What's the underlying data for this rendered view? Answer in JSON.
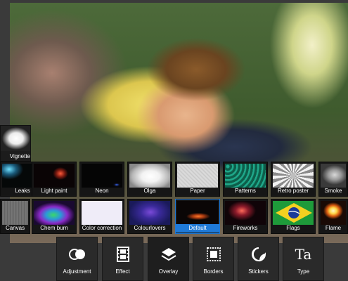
{
  "toolbar": {
    "items": [
      {
        "label": "Adjustment",
        "icon": "adjustment-icon"
      },
      {
        "label": "Effect",
        "icon": "film-icon"
      },
      {
        "label": "Overlay",
        "icon": "layers-icon"
      },
      {
        "label": "Borders",
        "icon": "stamp-border-icon"
      },
      {
        "label": "Stickers",
        "icon": "sticker-icon"
      },
      {
        "label": "Type",
        "icon": "type-icon"
      }
    ],
    "active": "Overlay"
  },
  "overlay_panel": {
    "vignette_label": "Vignette",
    "row1": [
      "Leaks",
      "Light paint",
      "Neon",
      "Olga",
      "Paper",
      "Patterns",
      "Retro poster",
      "Smoke"
    ],
    "row2": [
      "Canvas",
      "Chem burn",
      "Color correction",
      "Colourlovers",
      "Default",
      "Fireworks",
      "Flags",
      "Flame"
    ],
    "selected": "Default"
  },
  "icon_glyphs": {
    "type": "Ta"
  }
}
